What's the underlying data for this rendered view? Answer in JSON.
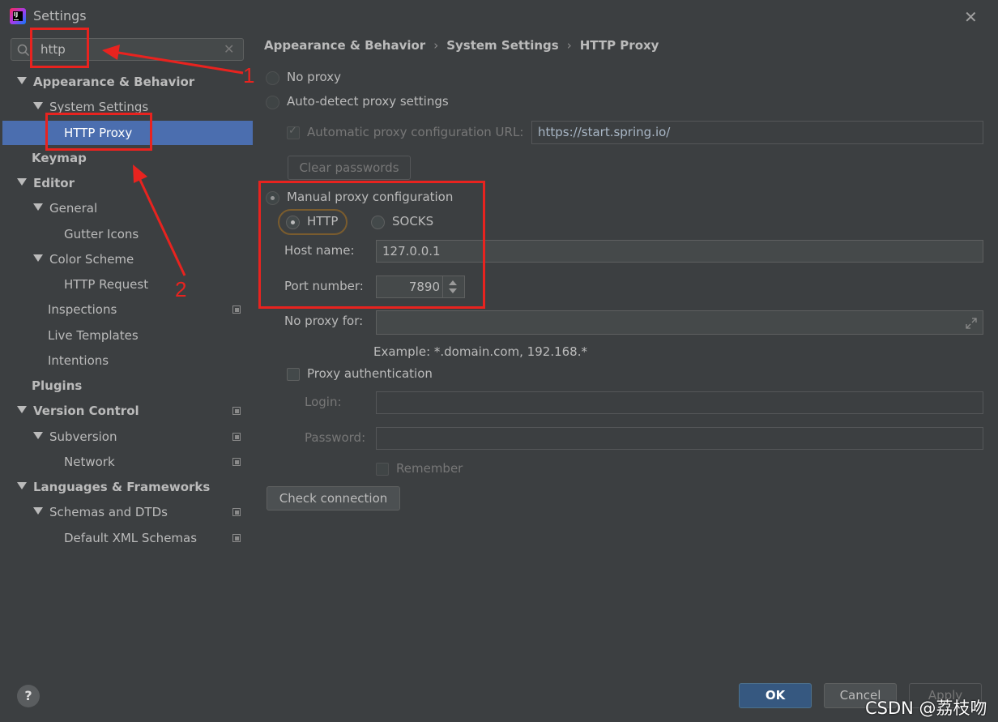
{
  "window": {
    "title": "Settings"
  },
  "search": {
    "value": "http"
  },
  "sidebar": {
    "items": [
      {
        "label": "Appearance & Behavior"
      },
      {
        "label": "System Settings"
      },
      {
        "label": "HTTP Proxy"
      },
      {
        "label": "Keymap"
      },
      {
        "label": "Editor"
      },
      {
        "label": "General"
      },
      {
        "label": "Gutter Icons"
      },
      {
        "label": "Color Scheme"
      },
      {
        "label": "HTTP Request"
      },
      {
        "label": "Inspections"
      },
      {
        "label": "Live Templates"
      },
      {
        "label": "Intentions"
      },
      {
        "label": "Plugins"
      },
      {
        "label": "Version Control"
      },
      {
        "label": "Subversion"
      },
      {
        "label": "Network"
      },
      {
        "label": "Languages & Frameworks"
      },
      {
        "label": "Schemas and DTDs"
      },
      {
        "label": "Default XML Schemas"
      }
    ]
  },
  "breadcrumb": [
    "Appearance & Behavior",
    "System Settings",
    "HTTP Proxy"
  ],
  "proxy": {
    "no_proxy": "No proxy",
    "auto_detect": "Auto-detect proxy settings",
    "auto_config_label": "Automatic proxy configuration URL:",
    "auto_config_url": "https://start.spring.io/",
    "clear_passwords": "Clear passwords",
    "manual": "Manual proxy configuration",
    "http": "HTTP",
    "socks": "SOCKS",
    "host_label": "Host name:",
    "host_value": "127.0.0.1",
    "port_label": "Port number:",
    "port_value": "7890",
    "no_proxy_for_label": "No proxy for:",
    "no_proxy_for_value": "",
    "example": "Example: *.domain.com, 192.168.*",
    "auth_label": "Proxy authentication",
    "login_label": "Login:",
    "password_label": "Password:",
    "remember_label": "Remember",
    "check_connection": "Check connection"
  },
  "footer": {
    "help": "?",
    "ok": "OK",
    "cancel": "Cancel",
    "apply": "Apply"
  },
  "annotations": {
    "one": "1",
    "two": "2"
  },
  "watermark": "CSDN @荔枝吻",
  "colors": {
    "selection": "#4b6eaf",
    "annotation": "#e8231f",
    "primary_button": "#365880"
  }
}
